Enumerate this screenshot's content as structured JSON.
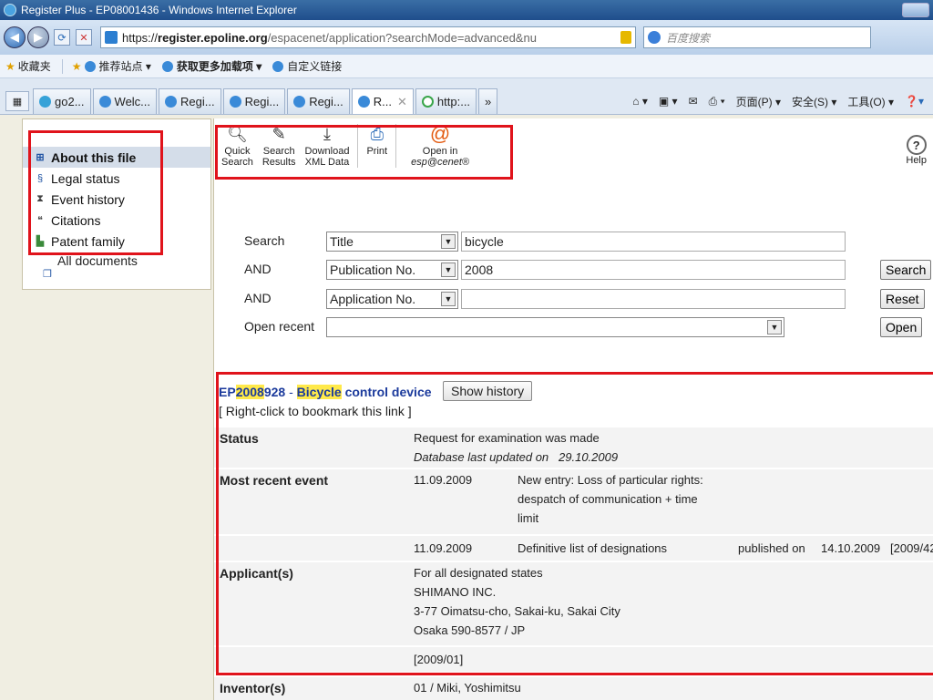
{
  "window": {
    "title": "Register Plus - EP08001436 - Windows Internet Explorer"
  },
  "address": {
    "scheme": "https://",
    "host": "register.epoline.org",
    "path": "/espacenet/application?searchMode=advanced&nu"
  },
  "search_provider": {
    "placeholder": "百度搜索"
  },
  "favorites": {
    "label": "收藏夹",
    "items": [
      "推荐站点 ▾",
      "获取更多加载项 ▾",
      "自定义链接"
    ]
  },
  "tabs": [
    {
      "label": "go2..."
    },
    {
      "label": "Welc..."
    },
    {
      "label": "Regi..."
    },
    {
      "label": "Regi..."
    },
    {
      "label": "Regi..."
    },
    {
      "label": "R..."
    },
    {
      "label": "http:..."
    }
  ],
  "command_bar": {
    "page": "页面(P) ▾",
    "safety": "安全(S) ▾",
    "tools": "工具(O) ▾"
  },
  "sidebar": {
    "items": [
      {
        "label": "About this file",
        "icon": "grid-icon",
        "glyph": "⊞"
      },
      {
        "label": "Legal status",
        "icon": "legal-status-icon",
        "glyph": "§"
      },
      {
        "label": "Event history",
        "icon": "hourglass-icon",
        "glyph": "⧗"
      },
      {
        "label": "Citations",
        "icon": "quote-icon",
        "glyph": "❝"
      },
      {
        "label": "Patent family",
        "icon": "family-tree-icon",
        "glyph": "▙"
      }
    ],
    "all_documents": "All documents"
  },
  "toolbar": {
    "quick_search": [
      "Quick",
      "Search"
    ],
    "search_results": [
      "Search",
      "Results"
    ],
    "download_xml": [
      "Download",
      "XML Data"
    ],
    "print": "Print",
    "open_in": [
      "Open in",
      "esp@cenet®"
    ],
    "help": "Help"
  },
  "search_form": {
    "rows": [
      {
        "label": "Search",
        "field": "Title",
        "value": "bicycle"
      },
      {
        "label": "AND",
        "field": "Publication No.",
        "value": "2008"
      },
      {
        "label": "AND",
        "field": "Application No.",
        "value": ""
      }
    ],
    "open_recent_label": "Open recent",
    "buttons": {
      "search": "Search",
      "reset": "Reset",
      "open": "Open"
    }
  },
  "result": {
    "number_prefix": "EP",
    "number_hl": "2008",
    "number_suffix": "928",
    "sep": " - ",
    "title_hl": "Bicycle",
    "title_rest": " control device",
    "show_history": "Show history",
    "bookmark_note": "[ Right-click to bookmark this link ]",
    "status": {
      "key": "Status",
      "line1": "Request for examination was made",
      "line2_label": "Database last updated on",
      "line2_date": "29.10.2009"
    },
    "most_recent_event": {
      "key": "Most recent event",
      "entries": [
        {
          "date": "11.09.2009",
          "text": [
            "New entry: Loss of particular rights:",
            "despatch of communication + time",
            "limit"
          ]
        },
        {
          "date": "11.09.2009",
          "text": [
            "Definitive list of designations"
          ],
          "published_label": "published on",
          "published_date": "14.10.2009",
          "bulletin": "[2009/42"
        }
      ]
    },
    "applicant": {
      "key": "Applicant(s)",
      "lines": [
        "For all designated states",
        "SHIMANO INC.",
        "3-77 Oimatsu-cho, Sakai-ku, Sakai City",
        "Osaka 590-8577 / JP"
      ],
      "bulletin": "[2009/01]"
    },
    "inventor": {
      "key": "Inventor(s)",
      "value": "01 / Miki, Yoshimitsu"
    }
  },
  "colors": {
    "annotation_red": "#e0131b",
    "highlight": "#ffe94a",
    "link_blue": "#1b3a9c"
  }
}
